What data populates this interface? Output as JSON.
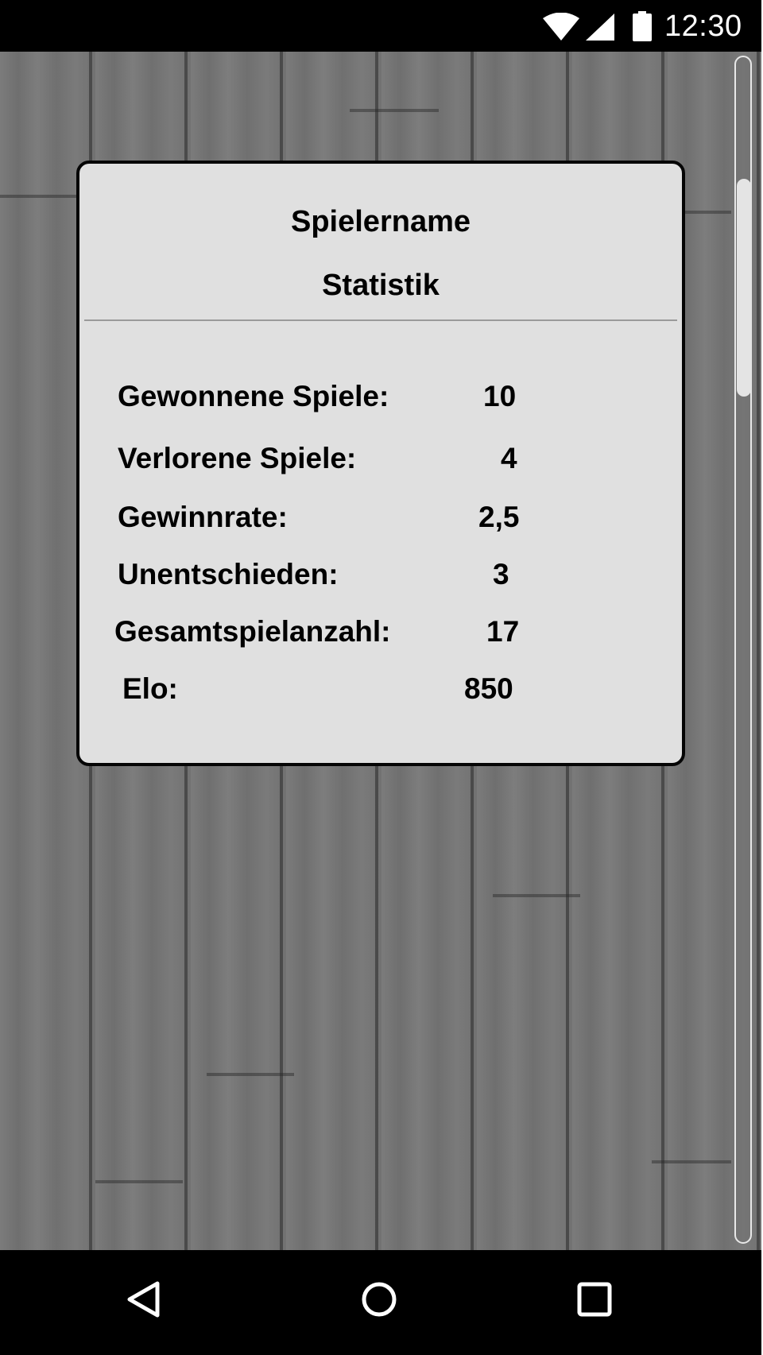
{
  "status_bar": {
    "time": "12:30",
    "icons": [
      "wifi-icon",
      "cell-signal-icon",
      "battery-icon"
    ]
  },
  "card": {
    "player_name": "Spielername",
    "section_title": "Statistik",
    "stats": [
      {
        "label": "Gewonnene Spiele:",
        "value": "10"
      },
      {
        "label": "Verlorene Spiele:",
        "value": "4"
      },
      {
        "label": "Gewinnrate:",
        "value": "2,5"
      },
      {
        "label": "Unentschieden:",
        "value": "3"
      },
      {
        "label": "Gesamtspielanzahl:",
        "value": "17"
      },
      {
        "label": "Elo:",
        "value": "850"
      }
    ]
  },
  "nav_bar": {
    "buttons": [
      "back-icon",
      "home-icon",
      "recents-icon"
    ]
  },
  "colors": {
    "card_background": "#e0e0e0",
    "card_border": "#050505",
    "wood_background": "#767676",
    "system_bars": "#000000"
  }
}
